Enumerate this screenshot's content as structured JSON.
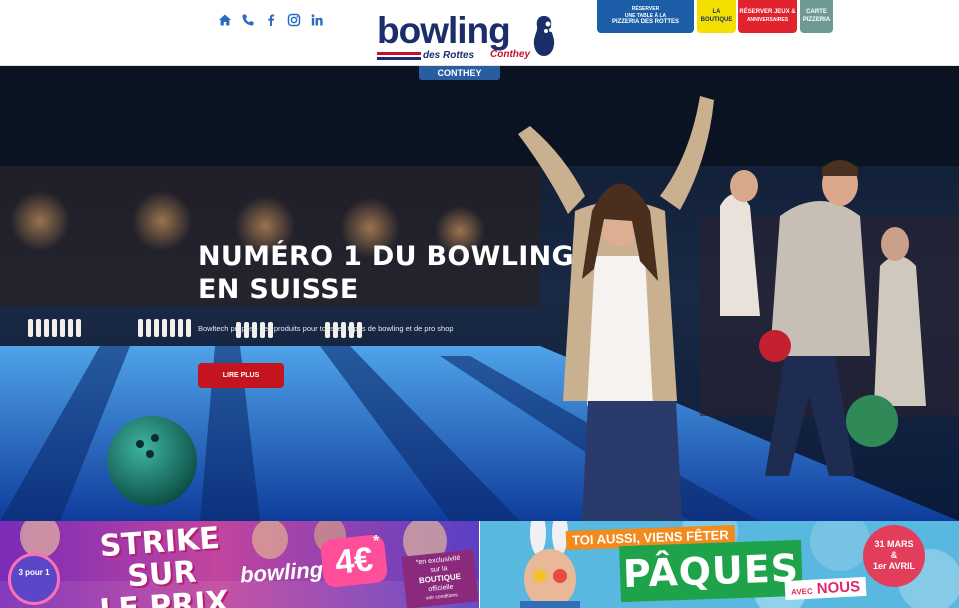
{
  "header": {
    "social_icons": [
      "home-icon",
      "phone-icon",
      "facebook-icon",
      "instagram-icon",
      "linkedin-icon"
    ],
    "logo": {
      "word": "bowling",
      "sub_left": "des Rottes",
      "sub_right": "Conthey"
    },
    "location_tab": "CONTHEY",
    "buttons": {
      "pizzeria_line1": "RÉSERVER",
      "pizzeria_line2": "UNE TABLE À LA",
      "pizzeria_line3": "PIZZERIA DES ROTTES",
      "boutique_line1": "LA",
      "boutique_line2": "BOUTIQUE",
      "reserver_line1": "RÉSERVER JEUX &",
      "reserver_line2": "ANNIVERSAIRES",
      "carte_line1": "CARTE",
      "carte_line2": "PIZZERIA"
    },
    "colors": {
      "brand_navy": "#1b2e6b",
      "brand_red": "#c8102e",
      "pizzeria": "#1c5ea8",
      "boutique": "#f4e000",
      "reserver": "#e1232f",
      "carte": "#6f9a93",
      "icons": "#2a6cc0"
    }
  },
  "hero": {
    "title_line1": "NUMÉRO 1 DU BOWLING",
    "title_line2": "EN SUISSE",
    "text": "Bowltech propose des produits pour tous les types de bowling et de pro shop",
    "button": "LIRE PLUS",
    "button_color": "#c3141f"
  },
  "promo_left": {
    "badge": "3 pour 1",
    "strike_line1": "STRIKE SUR",
    "strike_line2": "LE PRIX",
    "bowling_a": "bowling à",
    "price": "4€",
    "price_star": "*",
    "exclu_line1": "*en exclusivité",
    "exclu_line2": "sur la",
    "exclu_line3": "BOUTIQUE",
    "exclu_line4": "officielle",
    "exclu_line5": "voir conditions"
  },
  "promo_right": {
    "toi_aussi": "TOI AUSSI, VIENS FÊTER",
    "paques": "PÂQUES",
    "avec": "AVEC",
    "nous": "NOUS",
    "date_line1": "31 MARS",
    "date_line2": "&",
    "date_line3": "1er AVRIL"
  }
}
